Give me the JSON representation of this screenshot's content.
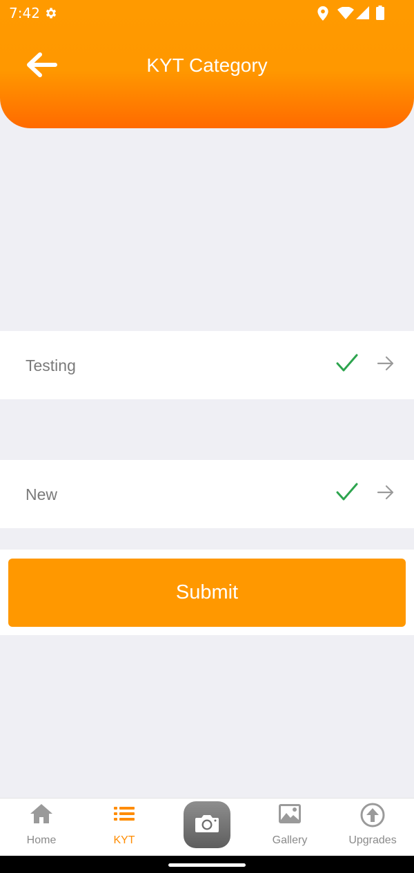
{
  "status_bar": {
    "time": "7:42",
    "icons": [
      "gear-icon",
      "location-icon",
      "wifi-icon",
      "signal-icon",
      "battery-icon"
    ]
  },
  "header": {
    "title": "KYT Category",
    "back_icon": "arrow-left-icon"
  },
  "categories": [
    {
      "label": "Testing",
      "status_icon": "check-icon",
      "action_icon": "arrow-right-icon"
    },
    {
      "label": "New",
      "status_icon": "check-icon",
      "action_icon": "arrow-right-icon"
    }
  ],
  "submit": {
    "label": "Submit"
  },
  "tabbar": {
    "items": [
      {
        "label": "Home",
        "icon": "home-icon",
        "active": false
      },
      {
        "label": "KYT",
        "icon": "list-icon",
        "active": true
      },
      {
        "label": "",
        "icon": "camera-icon",
        "active": false
      },
      {
        "label": "Gallery",
        "icon": "image-icon",
        "active": false
      },
      {
        "label": "Upgrades",
        "icon": "upgrade-icon",
        "active": false
      }
    ]
  },
  "colors": {
    "accent": "#FF9800",
    "header_bottom": "#FF6A00",
    "check": "#2DA44E",
    "background": "#EFEFF4"
  }
}
